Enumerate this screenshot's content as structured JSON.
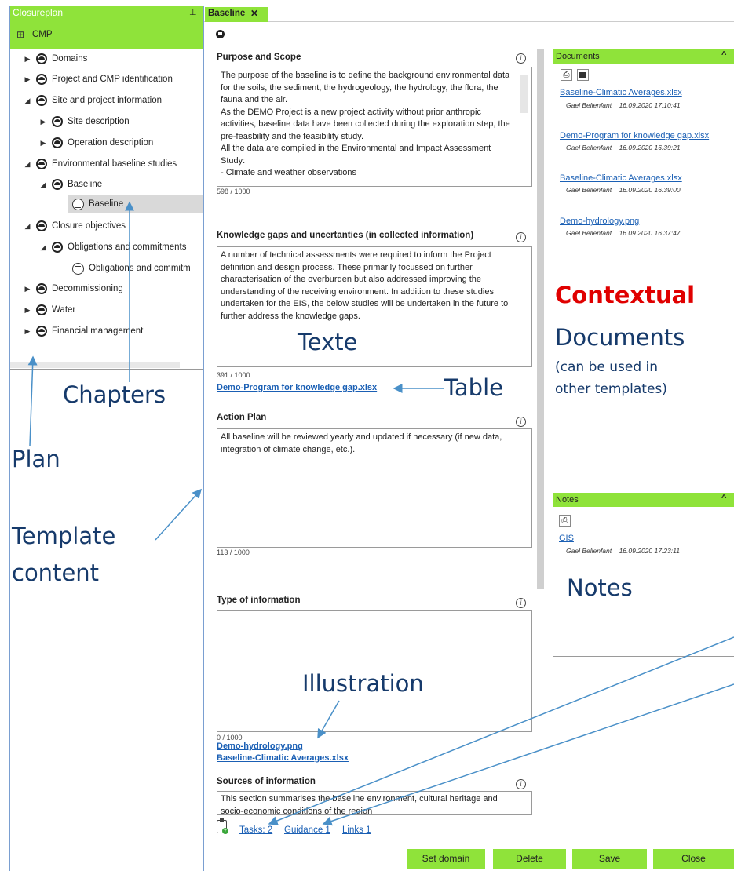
{
  "sidebar": {
    "title": "Closureplan",
    "pin_icon": "pin-icon",
    "root": "CMP",
    "items": [
      {
        "label": "Domains"
      },
      {
        "label": "Project and CMP identification"
      },
      {
        "label": "Site and project information"
      },
      {
        "label": "Site description"
      },
      {
        "label": "Operation description"
      },
      {
        "label": "Environmental baseline studies"
      },
      {
        "label": "Baseline"
      },
      {
        "label": "Baseline"
      },
      {
        "label": "Closure objectives"
      },
      {
        "label": "Obligations and commitments"
      },
      {
        "label": "Obligations and commitm"
      },
      {
        "label": "Decommissioning"
      },
      {
        "label": "Water"
      },
      {
        "label": "Financial management"
      }
    ]
  },
  "tab": {
    "label": "Baseline",
    "close": "✕"
  },
  "sections": {
    "purpose": {
      "label": "Purpose and Scope",
      "text": "The purpose of the baseline is to define the background environmental data for the soils, the sediment, the hydrogeology, the hydrology, the flora, the fauna and the air.\nAs the DEMO Project is a new project activity without prior anthropic activities, baseline data have been collected during the exploration step, the pre-feasbility and the feasibility study.\nAll the data are compiled in the Environmental and Impact Assessment Study:\n- Climate and weather observations",
      "count": "598 / 1000"
    },
    "gaps": {
      "label": "Knowledge gaps and uncertanties (in collected information)",
      "text": "A number of technical assessments were required to inform the Project definition and design process. These primarily focussed on further characterisation of the overburden but also addressed improving the understanding of the receiving environment. In addition to these studies undertaken for the EIS, the below studies will be undertaken in the future to further address the knowledge gaps.",
      "count": "391 / 1000",
      "link": "Demo-Program for knowledge gap.xlsx"
    },
    "action": {
      "label": "Action Plan",
      "text": "All baseline will be reviewed yearly and updated if necessary (if new data, integration of climate change, etc.).",
      "count": "113 / 1000"
    },
    "type": {
      "label": "Type of information",
      "text": "",
      "count": "0 / 1000",
      "links": [
        "Demo-hydrology.png",
        "Baseline-Climatic Averages.xlsx"
      ]
    },
    "sources": {
      "label": "Sources of information",
      "text": "This section summarises the baseline environment, cultural heritage and socio-economic conditions of the region"
    }
  },
  "footer": {
    "tasks": "Tasks: 2",
    "guidance": "Guidance 1",
    "links": "Links 1",
    "buttons": {
      "set_domain": "Set domain",
      "delete": "Delete",
      "save": "Save",
      "close": "Close"
    }
  },
  "documents": {
    "title": "Documents",
    "items": [
      {
        "name": "Baseline-Climatic Averages.xlsx",
        "author": "Gael Bellenfant",
        "date": "16.09.2020 17:10:41"
      },
      {
        "name": "Demo-Program for knowledge gap.xlsx",
        "author": "Gael Bellenfant",
        "date": "16.09.2020 16:39:21"
      },
      {
        "name": "Baseline-Climatic Averages.xlsx",
        "author": "Gael Bellenfant",
        "date": "16.09.2020 16:39:00"
      },
      {
        "name": "Demo-hydrology.png",
        "author": "Gael Bellenfant",
        "date": "16.09.2020 16:37:47"
      }
    ]
  },
  "notes": {
    "title": "Notes",
    "items": [
      {
        "name": "GIS",
        "author": "Gael Bellenfant",
        "date": "16.09.2020 17:23:11"
      }
    ]
  },
  "annotations": {
    "contextual": "Contextual",
    "documents": "Documents",
    "documents_sub1": "(can be used in",
    "documents_sub2": "other templates)",
    "texte": "Texte",
    "table": "Table",
    "chapters": "Chapters",
    "plan": "Plan",
    "template1": "Template",
    "template2": "content",
    "notes": "Notes",
    "illustration": "Illustration"
  },
  "colors": {
    "accent": "#8fe33a",
    "link": "#1a5fb4",
    "annotation": "#163a6b",
    "annotation_red": "#e00000",
    "arrow": "#4a90c8"
  }
}
